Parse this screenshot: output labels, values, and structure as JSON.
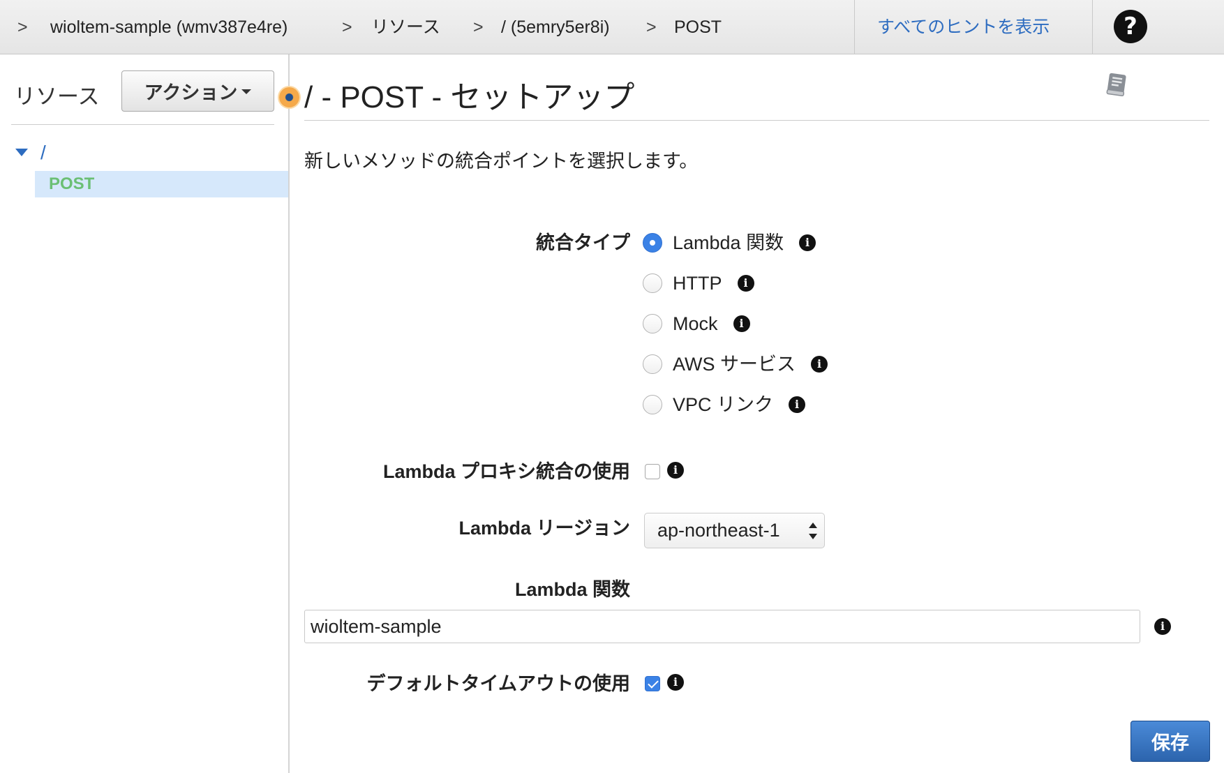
{
  "theme": {
    "link": "#2d6cc0",
    "accent": "#3b82e6",
    "tree_selected_bg": "#d6e8fb",
    "tree_selected_text": "#6bbf74",
    "handle": "#f5a94a",
    "save_top": "#4a8ad8",
    "save": "#2c64ad"
  },
  "breadcrumb": {
    "separator": ">",
    "items": [
      "wioltem-sample (wmv387e4re)",
      "リソース",
      "/ (5emry5er8i)",
      "POST"
    ]
  },
  "header": {
    "hints_link": "すべてのヒントを表示",
    "help_icon": "question-circle-icon"
  },
  "sidebar": {
    "title": "リソース",
    "actions_button": "アクション",
    "tree": {
      "root": "/",
      "children": [
        {
          "label": "POST",
          "selected": true
        }
      ]
    }
  },
  "main": {
    "title": "/ - POST - セットアップ",
    "book_icon": "documentation-book-icon",
    "description": "新しいメソッドの統合ポイントを選択します。",
    "form": {
      "integration_type": {
        "label": "統合タイプ",
        "options": [
          {
            "label": "Lambda 関数",
            "selected": true
          },
          {
            "label": "HTTP",
            "selected": false
          },
          {
            "label": "Mock",
            "selected": false
          },
          {
            "label": "AWS サービス",
            "selected": false
          },
          {
            "label": "VPC リンク",
            "selected": false
          }
        ]
      },
      "lambda_proxy": {
        "label": "Lambda プロキシ統合の使用",
        "checked": false
      },
      "lambda_region": {
        "label": "Lambda リージョン",
        "value": "ap-northeast-1"
      },
      "lambda_function": {
        "label": "Lambda 関数",
        "value": "wioltem-sample"
      },
      "default_timeout": {
        "label": "デフォルトタイムアウトの使用",
        "checked": true
      }
    },
    "save_button": "保存"
  }
}
